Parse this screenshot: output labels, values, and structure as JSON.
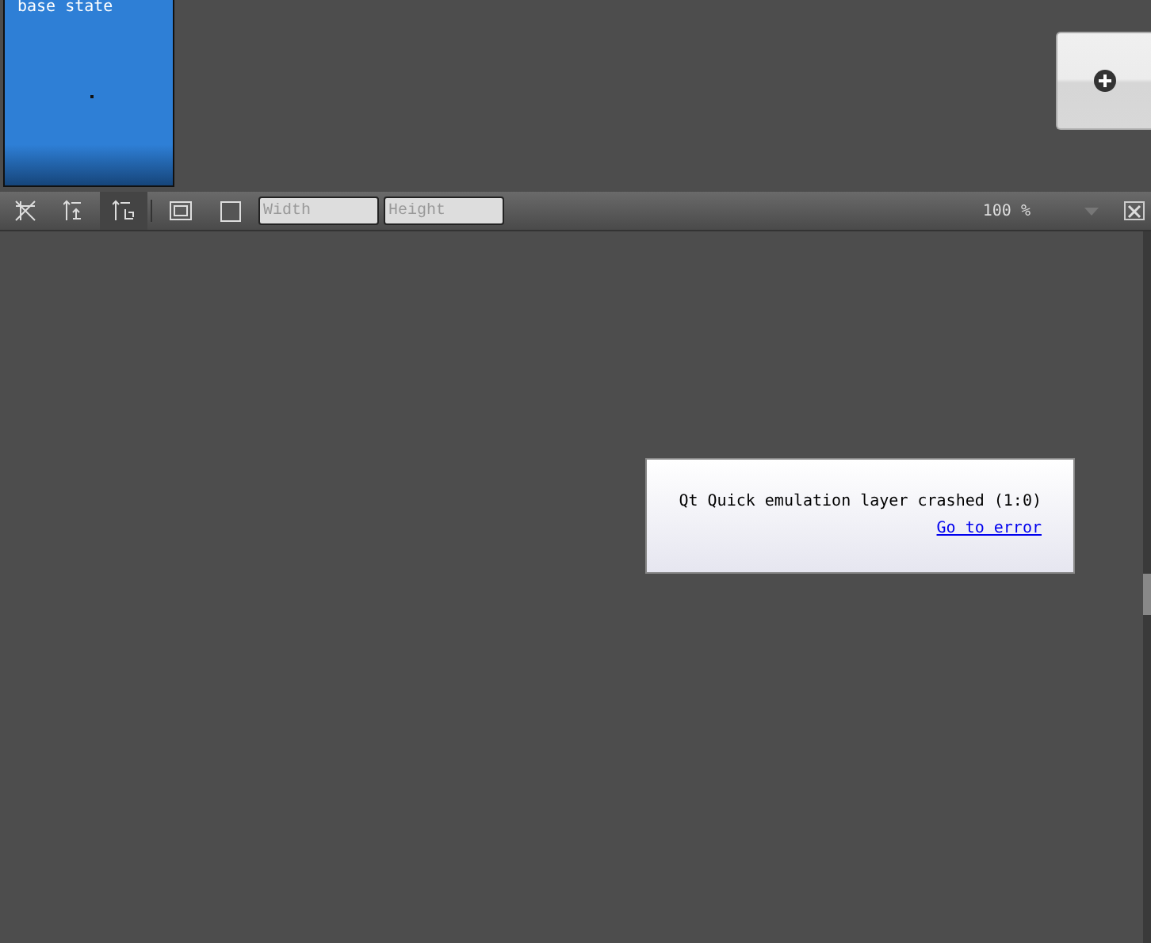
{
  "states": [
    {
      "label": "base state",
      "selected": true
    }
  ],
  "toolbar": {
    "tools": [
      {
        "kind": "fit",
        "selected": false
      },
      {
        "kind": "height",
        "selected": false
      },
      {
        "kind": "anchor",
        "selected": true
      },
      {
        "kind": "frame",
        "selected": false
      },
      {
        "kind": "square",
        "selected": false
      }
    ],
    "width_field": {
      "placeholder": "Width"
    },
    "height_field": {
      "placeholder": "Height"
    },
    "zoom": "100 %"
  },
  "error": {
    "message": "Qt Quick emulation layer crashed (1:0)",
    "link": "Go to error"
  }
}
